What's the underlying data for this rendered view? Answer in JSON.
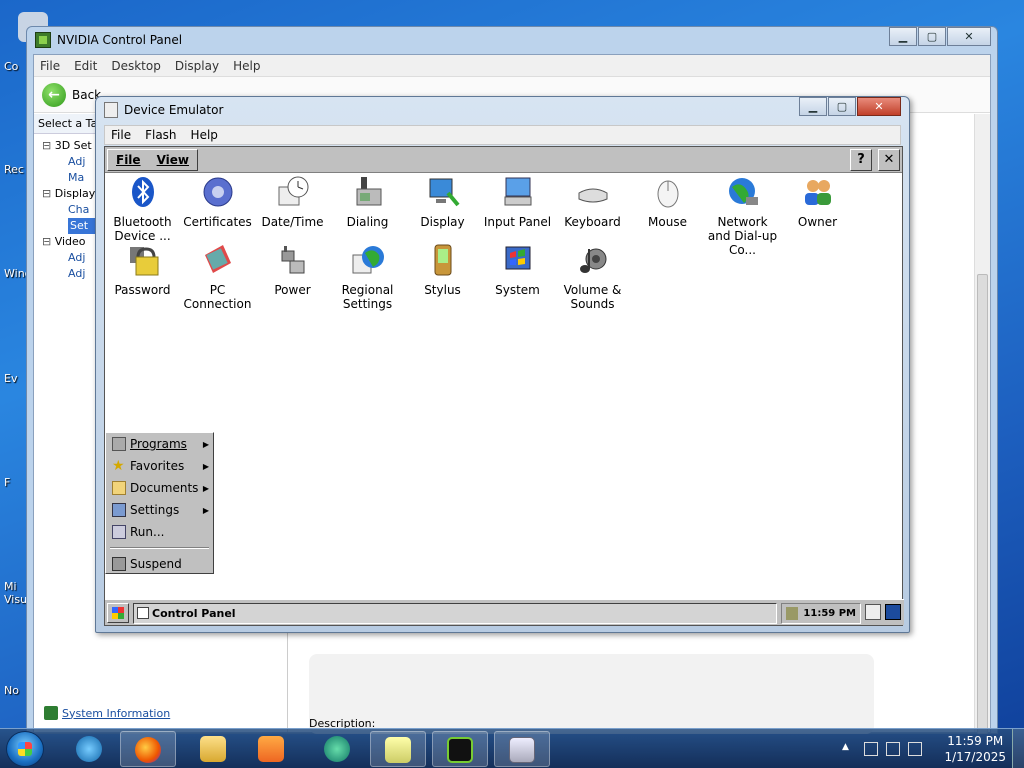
{
  "desktop": {
    "icon_labels": [
      "Co",
      "Rec",
      "Wind",
      "Ev",
      "F",
      "Mi\nVisu",
      "No"
    ]
  },
  "nvidia": {
    "title": "NVIDIA Control Panel",
    "menu": [
      "File",
      "Edit",
      "Desktop",
      "Display",
      "Help"
    ],
    "back_label": "Back",
    "task_header": "Select a Tas",
    "tree": [
      {
        "label": "3D Set",
        "type": "node"
      },
      {
        "label": "Adj",
        "type": "leaf"
      },
      {
        "label": "Ma",
        "type": "leaf"
      },
      {
        "label": "Display",
        "type": "node"
      },
      {
        "label": "Cha",
        "type": "leaf"
      },
      {
        "label": "Set",
        "type": "leaf-selected"
      },
      {
        "label": "Video",
        "type": "node"
      },
      {
        "label": "Adj",
        "type": "leaf"
      },
      {
        "label": "Adj",
        "type": "leaf"
      }
    ],
    "system_information": "System Information",
    "description_label": "Description:"
  },
  "emulator": {
    "title": "Device Emulator",
    "menu": [
      "File",
      "Flash",
      "Help"
    ],
    "ce_menu": [
      "File",
      "View"
    ],
    "help_btn": "?",
    "close_btn": "✕",
    "items": [
      {
        "label": "Bluetooth Device ...",
        "icon": "bluetooth-icon",
        "color": "#1a56c8"
      },
      {
        "label": "Certificates",
        "icon": "certificates-icon",
        "color": "#5a6fcf"
      },
      {
        "label": "Date/Time",
        "icon": "date-time-icon",
        "color": "#7a8aa0"
      },
      {
        "label": "Dialing",
        "icon": "dialing-icon",
        "color": "#556"
      },
      {
        "label": "Display",
        "icon": "display-icon",
        "color": "#2b8a6a"
      },
      {
        "label": "Input Panel",
        "icon": "input-panel-icon",
        "color": "#3a78c8"
      },
      {
        "label": "Keyboard",
        "icon": "keyboard-icon",
        "color": "#888"
      },
      {
        "label": "Mouse",
        "icon": "mouse-icon",
        "color": "#ccc"
      },
      {
        "label": "Network and Dial-up Co...",
        "icon": "network-icon",
        "color": "#2d7d3a"
      },
      {
        "label": "Owner",
        "icon": "owner-icon",
        "color": "#c86a2b"
      },
      {
        "label": "Password",
        "icon": "password-icon",
        "color": "#d4b82a"
      },
      {
        "label": "PC Connection",
        "icon": "pc-connection-icon",
        "color": "#cc3a3a"
      },
      {
        "label": "Power",
        "icon": "power-icon",
        "color": "#7d7d9a"
      },
      {
        "label": "Regional Settings",
        "icon": "regional-settings-icon",
        "color": "#2a7ab8"
      },
      {
        "label": "Stylus",
        "icon": "stylus-icon",
        "color": "#b8862a"
      },
      {
        "label": "System",
        "icon": "system-icon",
        "color": "#3a6ac8"
      },
      {
        "label": "Volume & Sounds",
        "icon": "volume-sounds-icon",
        "color": "#6a5a3a"
      }
    ],
    "start_menu": [
      {
        "label": "Programs",
        "submenu": true
      },
      {
        "label": "Favorites",
        "submenu": true
      },
      {
        "label": "Documents",
        "submenu": true
      },
      {
        "label": "Settings",
        "submenu": true
      },
      {
        "label": "Run...",
        "submenu": false
      },
      {
        "label": "Suspend",
        "submenu": false
      }
    ],
    "taskbar_button": "Control Panel",
    "ce_clock": "11:59 PM"
  },
  "taskbar": {
    "time": "11:59 PM",
    "date": "1/17/2025"
  }
}
